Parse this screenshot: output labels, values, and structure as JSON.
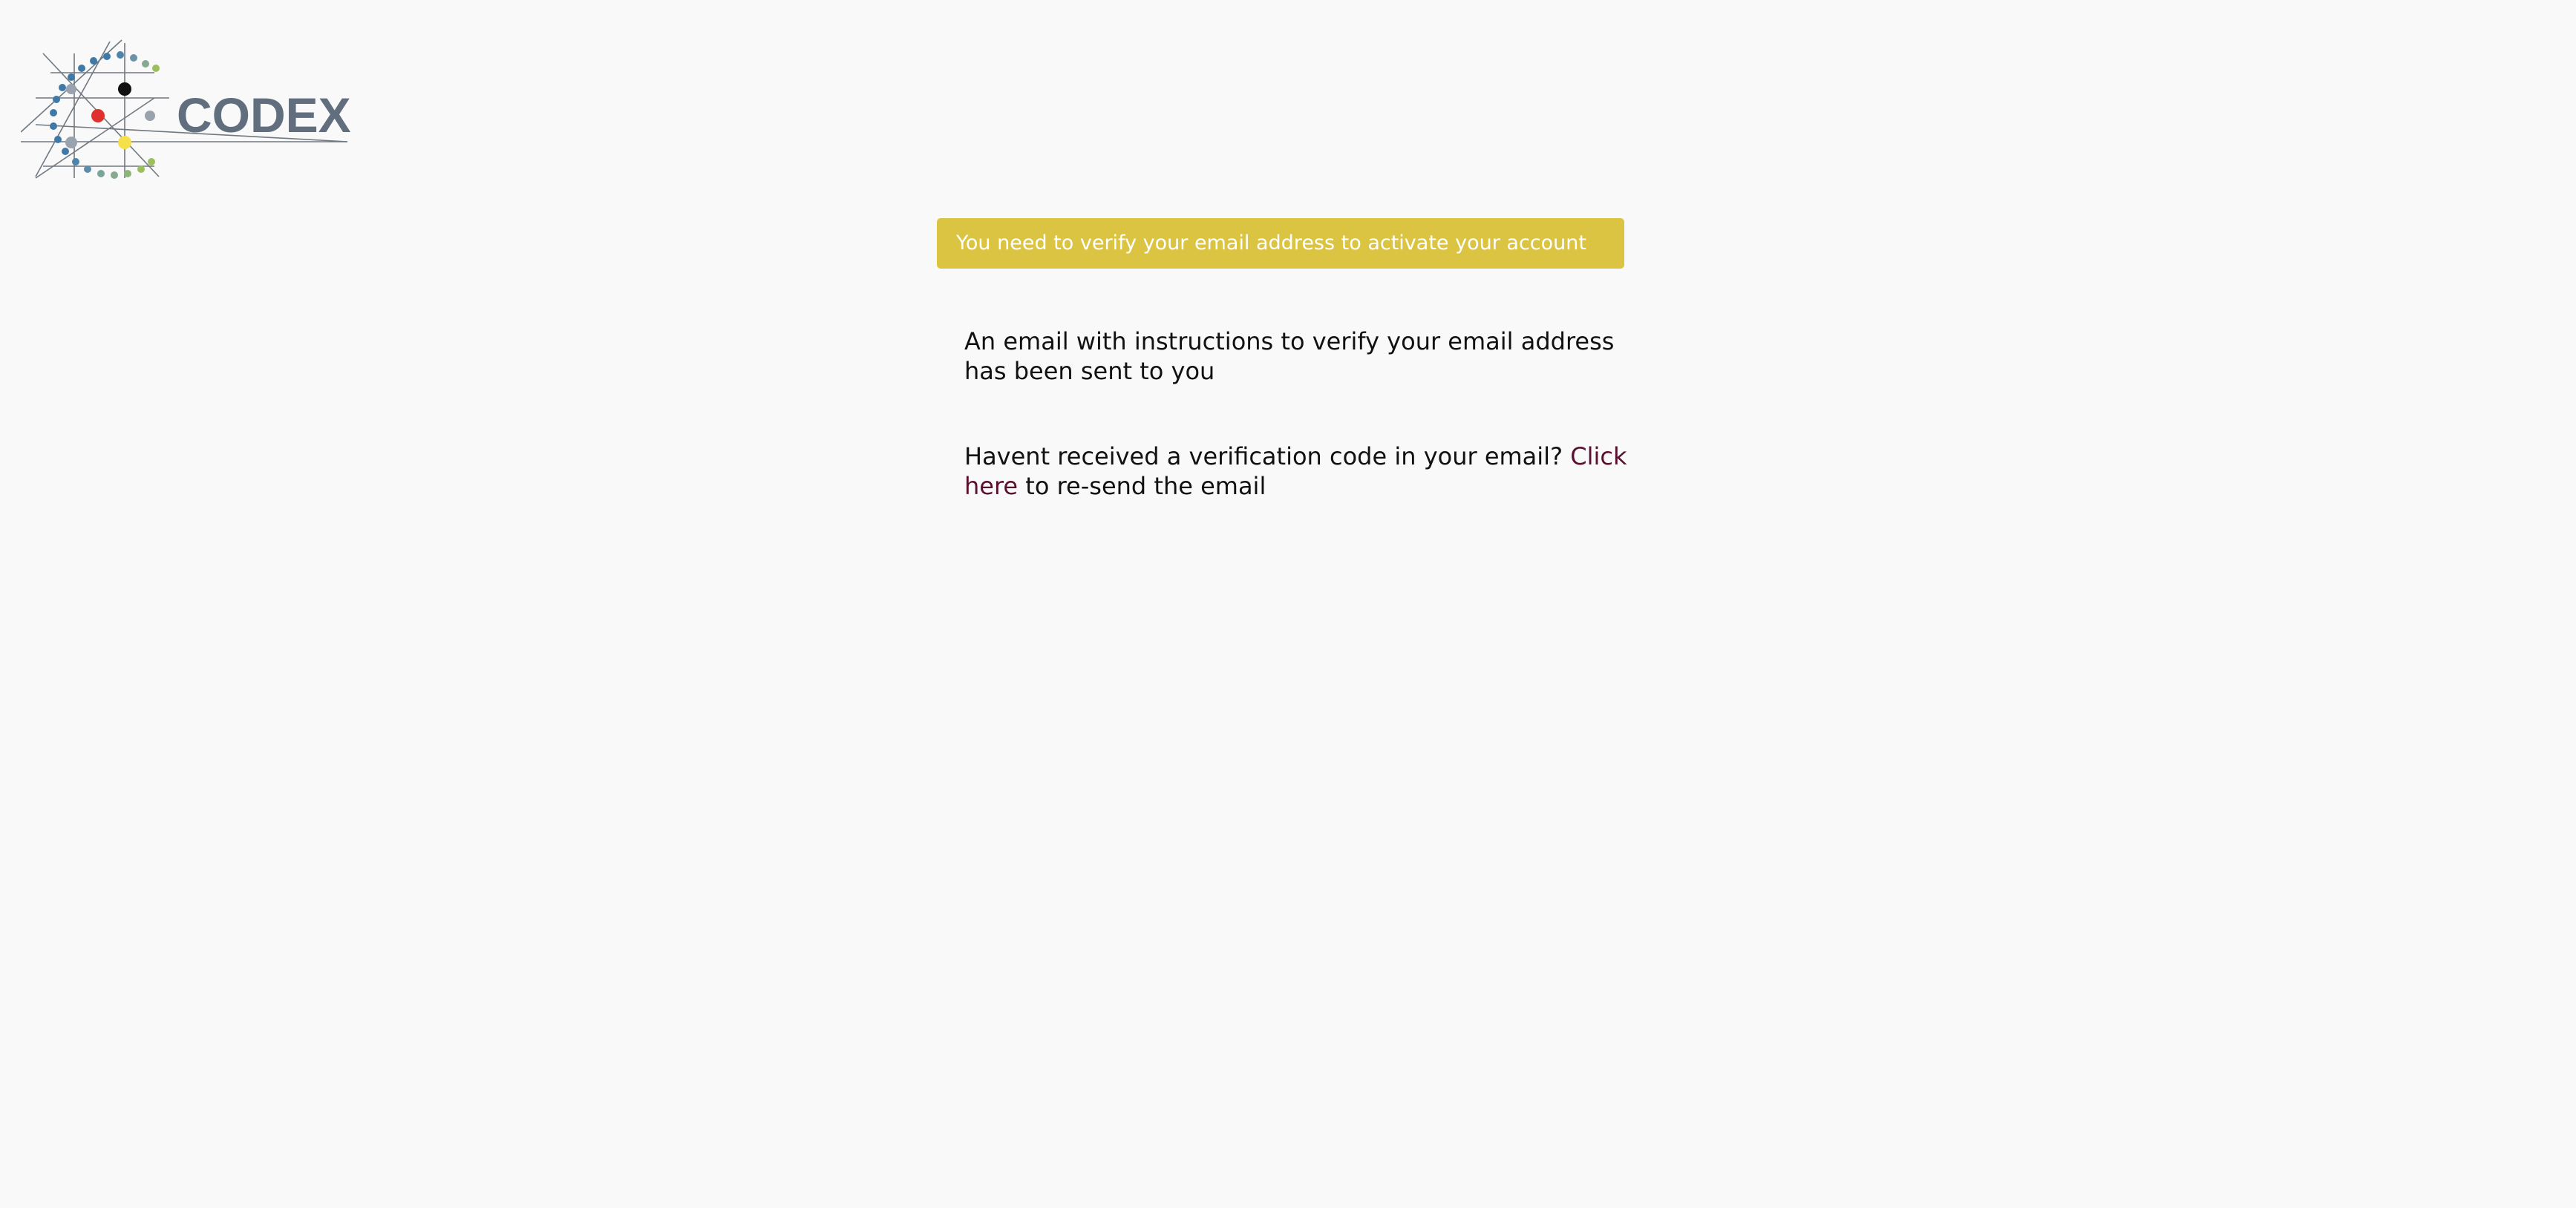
{
  "logo": {
    "text": "CODEX",
    "icon": "codex-network-logo",
    "colors": {
      "text": "#616e7e",
      "dots_blue": "#3f79a8",
      "dots_green": "#9bbf5c",
      "node_red": "#e0302e",
      "node_black": "#111111",
      "node_grey": "#9aa3ad",
      "node_yellow": "#f4e04a"
    }
  },
  "alert": {
    "message": "You need to verify your email address to activate your account",
    "color": "#dcc443"
  },
  "content": {
    "instructions": "An email with instructions to verify your email address has been sent to you",
    "resend_prefix": "Havent received a verification code in your email? ",
    "resend_link": "Click here",
    "resend_suffix": " to re-send the email",
    "link_color": "#5b0f2e"
  }
}
